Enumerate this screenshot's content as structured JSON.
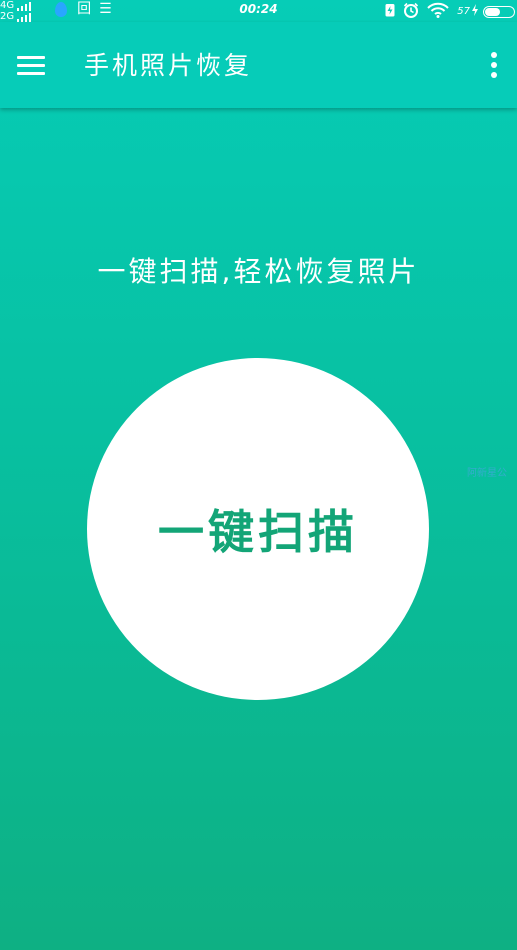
{
  "status_bar": {
    "network_top": "4G",
    "network_bottom": "2G",
    "notif_1": "回",
    "notif_2": "☰",
    "time": "00:24",
    "battery_percent": "57",
    "battery_level": 0.57
  },
  "app_bar": {
    "title": "手机照片恢复"
  },
  "main": {
    "tagline": "一键扫描,轻松恢复照片",
    "scan_button_label": "一键扫描",
    "side_hint": "阿新星公"
  },
  "colors": {
    "background_top": "#06cdb7",
    "background_bottom": "#0eb083",
    "accent_text": "#13a577"
  }
}
